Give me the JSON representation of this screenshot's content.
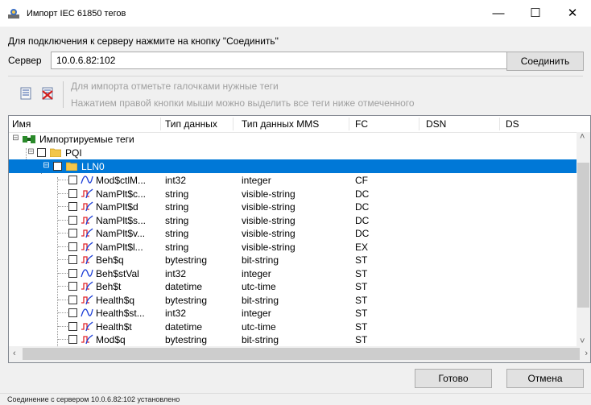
{
  "window": {
    "title": "Импорт IEC 61850 тегов",
    "minimize_glyph": "—",
    "maximize_glyph": "☐",
    "close_glyph": "✕"
  },
  "prompt": "Для подключения к серверу нажмите на кнопку \"Соединить\"",
  "server": {
    "label": "Сервер",
    "value": "10.0.6.82:102",
    "connect_label": "Соединить"
  },
  "toolbar": {
    "icons": [
      "check-list-icon",
      "uncheck-list-icon"
    ],
    "hint_line1": "Для импорта отметьте галочками нужные теги",
    "hint_line2": "Нажатием правой кнопки мыши можно выделить все теги ниже отмеченного"
  },
  "columns": [
    "Имя",
    "Тип данных",
    "Тип данных MMS",
    "FC",
    "DSN",
    "DS"
  ],
  "tree": {
    "root": "Импортируемые теги",
    "device": "PQI",
    "node": "LLN0",
    "rows": [
      {
        "name": "Mod$ctlM...",
        "type": "int32",
        "mms": "integer",
        "fc": "CF",
        "icon": "analog-signal-icon"
      },
      {
        "name": "NamPlt$c...",
        "type": "string",
        "mms": "visible-string",
        "fc": "DC",
        "icon": "discrete-signal-icon"
      },
      {
        "name": "NamPlt$d",
        "type": "string",
        "mms": "visible-string",
        "fc": "DC",
        "icon": "discrete-signal-icon"
      },
      {
        "name": "NamPlt$s...",
        "type": "string",
        "mms": "visible-string",
        "fc": "DC",
        "icon": "discrete-signal-icon"
      },
      {
        "name": "NamPlt$v...",
        "type": "string",
        "mms": "visible-string",
        "fc": "DC",
        "icon": "discrete-signal-icon"
      },
      {
        "name": "NamPlt$l...",
        "type": "string",
        "mms": "visible-string",
        "fc": "EX",
        "icon": "discrete-signal-icon"
      },
      {
        "name": "Beh$q",
        "type": "bytestring",
        "mms": "bit-string",
        "fc": "ST",
        "icon": "discrete-signal-icon"
      },
      {
        "name": "Beh$stVal",
        "type": "int32",
        "mms": "integer",
        "fc": "ST",
        "icon": "analog-signal-icon"
      },
      {
        "name": "Beh$t",
        "type": "datetime",
        "mms": "utc-time",
        "fc": "ST",
        "icon": "discrete-signal-icon"
      },
      {
        "name": "Health$q",
        "type": "bytestring",
        "mms": "bit-string",
        "fc": "ST",
        "icon": "discrete-signal-icon"
      },
      {
        "name": "Health$st...",
        "type": "int32",
        "mms": "integer",
        "fc": "ST",
        "icon": "analog-signal-icon"
      },
      {
        "name": "Health$t",
        "type": "datetime",
        "mms": "utc-time",
        "fc": "ST",
        "icon": "discrete-signal-icon"
      },
      {
        "name": "Mod$q",
        "type": "bytestring",
        "mms": "bit-string",
        "fc": "ST",
        "icon": "discrete-signal-icon"
      }
    ]
  },
  "buttons": {
    "done": "Готово",
    "cancel": "Отмена"
  },
  "status": "Соединение с сервером 10.0.6.82:102 установлено",
  "colors": {
    "selection": "#0078d7",
    "signal_blue": "#1a3cd6",
    "signal_red": "#e0242a",
    "folder": "#f3c64a"
  }
}
